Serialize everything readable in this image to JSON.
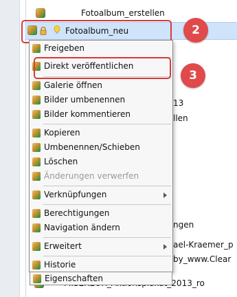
{
  "tree": {
    "rows": [
      {
        "label": "Fotoalbum_erstellen"
      },
      {
        "label": "Fotoalbum_neu"
      },
      {
        "label": "13"
      },
      {
        "label": "llen"
      },
      {
        "label": "ngen"
      },
      {
        "label": "ael-Kraemer_p"
      },
      {
        "label": "by_www.Clear"
      },
      {
        "label": "MISEREOR_Aktionsplakat_2013_ro"
      }
    ]
  },
  "context_menu": {
    "items": [
      {
        "label": "Freigeben"
      },
      {
        "label": "Direkt veröffentlichen"
      },
      {
        "label": "Galerie öffnen"
      },
      {
        "label": "Bilder umbenennen"
      },
      {
        "label": "Bilder kommentieren"
      },
      {
        "label": "Kopieren"
      },
      {
        "label": "Umbenennen/Schieben"
      },
      {
        "label": "Löschen"
      },
      {
        "label": "Änderungen verwerfen"
      },
      {
        "label": "Verknüpfungen"
      },
      {
        "label": "Berechtigungen"
      },
      {
        "label": "Navigation ändern"
      },
      {
        "label": "Erweitert"
      },
      {
        "label": "Historie"
      },
      {
        "label": "Eigenschaften"
      }
    ]
  },
  "annotations": {
    "step2": "2",
    "step3": "3"
  },
  "colors": {
    "highlight": "#d63a3a",
    "badge": "#e04a4a",
    "selection": "#cfe3fb"
  },
  "icons": {
    "node": "folder-globe-icon",
    "lock": "lock-icon",
    "bulb": "lightbulb-icon",
    "submenu": "chevron-right-icon"
  }
}
